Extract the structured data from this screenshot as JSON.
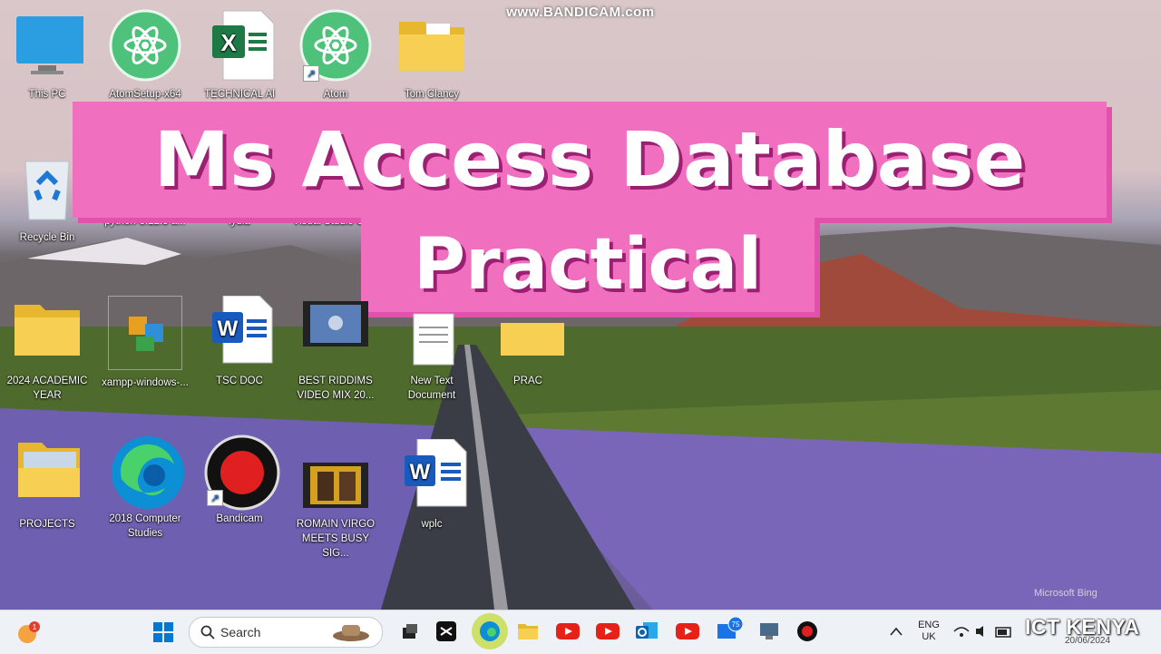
{
  "watermark": "www.BANDICAM.com",
  "overlay": {
    "title_line1": "Ms Access Database",
    "title_line2": "Practical"
  },
  "desktop_icons": [
    {
      "label": "This PC"
    },
    {
      "label": "AtomSetup-x64"
    },
    {
      "label": "TECHNICAL Al"
    },
    {
      "label": "Atom"
    },
    {
      "label": "Tom Clancy"
    },
    {
      "label": "Recycle Bin"
    },
    {
      "label": "python-3.12.3 a..."
    },
    {
      "label": "lydia"
    },
    {
      "label": "Visual Studio C"
    },
    {
      "label": "2024 ACADEMIC YEAR"
    },
    {
      "label": "xampp-windows-..."
    },
    {
      "label": "TSC DOC"
    },
    {
      "label": "BEST RIDDIMS VIDEO MIX 20..."
    },
    {
      "label": "New Text Document"
    },
    {
      "label": "PRAC"
    },
    {
      "label": "PROJECTS"
    },
    {
      "label": "2018 Computer Studies"
    },
    {
      "label": "Bandicam"
    },
    {
      "label": "ROMAIN VIRGO MEETS BUSY SIG..."
    },
    {
      "label": "wplc"
    }
  ],
  "taskbar": {
    "search_placeholder": "Search",
    "notification_badge": "1",
    "mail_badge": "75",
    "language_line1": "ENG",
    "language_line2": "UK",
    "date_partial": "20/06/2024"
  },
  "desktop_footer": {
    "bing_mark": "Microsoft Bing",
    "channel_brand": "ICT KENYA"
  },
  "colors": {
    "title_bg": "#f06fbf",
    "title_shadow": "#9b1f73",
    "taskbar_bg": "#eef1f6",
    "accent": "#0067c0"
  }
}
